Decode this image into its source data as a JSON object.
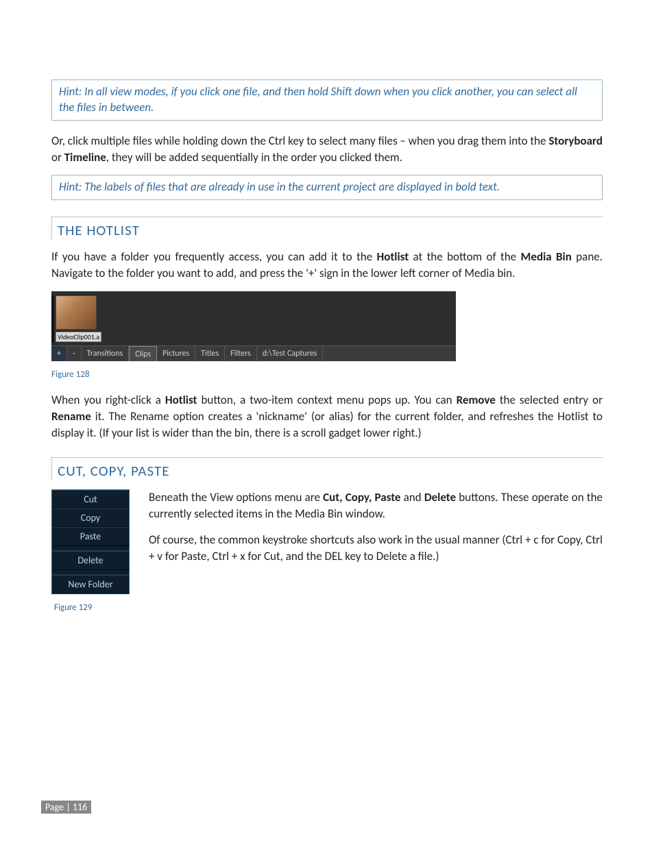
{
  "hints": {
    "shift_select": "Hint: In all view modes, if you click one file, and then hold Shift down when you click another, you can select all the files in between.",
    "bold_used": "Hint: The labels of files that are already in use in the current project are displayed in bold text."
  },
  "paragraphs": {
    "ctrl_select_a": "Or, click multiple files while holding down the Ctrl key to select many files – when you drag them into the ",
    "storyboard": "Storyboard",
    "ctrl_select_b": " or ",
    "timeline": "Timeline",
    "ctrl_select_c": ", they will be added sequentially in the order you clicked them.",
    "hotlist_a": "If you have a folder you frequently access, you can add it to the ",
    "hotlist_bold": "Hotlist",
    "hotlist_b": " at the bottom of the ",
    "mediabin_bold": "Media Bin",
    "hotlist_c": " pane. Navigate to the folder you want to add, and press the '+' sign in the lower left corner of Media bin.",
    "rc_a": "When you right-click a ",
    "rc_b": " button, a two-item context menu pops up.  You can ",
    "remove_bold": "Remove",
    "rc_c": " the selected entry or ",
    "rename_bold": "Rename",
    "rc_d": " it.   The Rename option creates a 'nickname' (or alias) for the current folder, and refreshes the Hotlist to display it. (If your list is wider than the bin, there is a scroll gadget lower right.)",
    "ccp_a": "Beneath the View options menu are ",
    "ccp_bold": "Cut, Copy, Paste",
    "ccp_b": " and ",
    "delete_bold": "Delete",
    "ccp_c": " buttons. These operate on the currently selected items in the Media Bin window.",
    "ccp2": "Of course, the common keystroke shortcuts also work in the usual manner (Ctrl + c for Copy, Ctrl + v for Paste, Ctrl + x for Cut, and the DEL key to Delete a file.)"
  },
  "headers": {
    "hotlist": "THE HOTLIST",
    "ccp": "CUT, COPY, PASTE"
  },
  "figure128": {
    "thumb_label": "VideoClip001.a",
    "plus": "+",
    "minus": "-",
    "tabs": [
      "Transitions",
      "Clips",
      "Pictures",
      "Titles",
      "Filters",
      "d:\\Test Captures"
    ],
    "caption": "Figure 128"
  },
  "figure129": {
    "items": [
      "Cut",
      "Copy",
      "Paste",
      "Delete",
      "New Folder"
    ],
    "caption": "Figure 129"
  },
  "footer": "Page | 116"
}
